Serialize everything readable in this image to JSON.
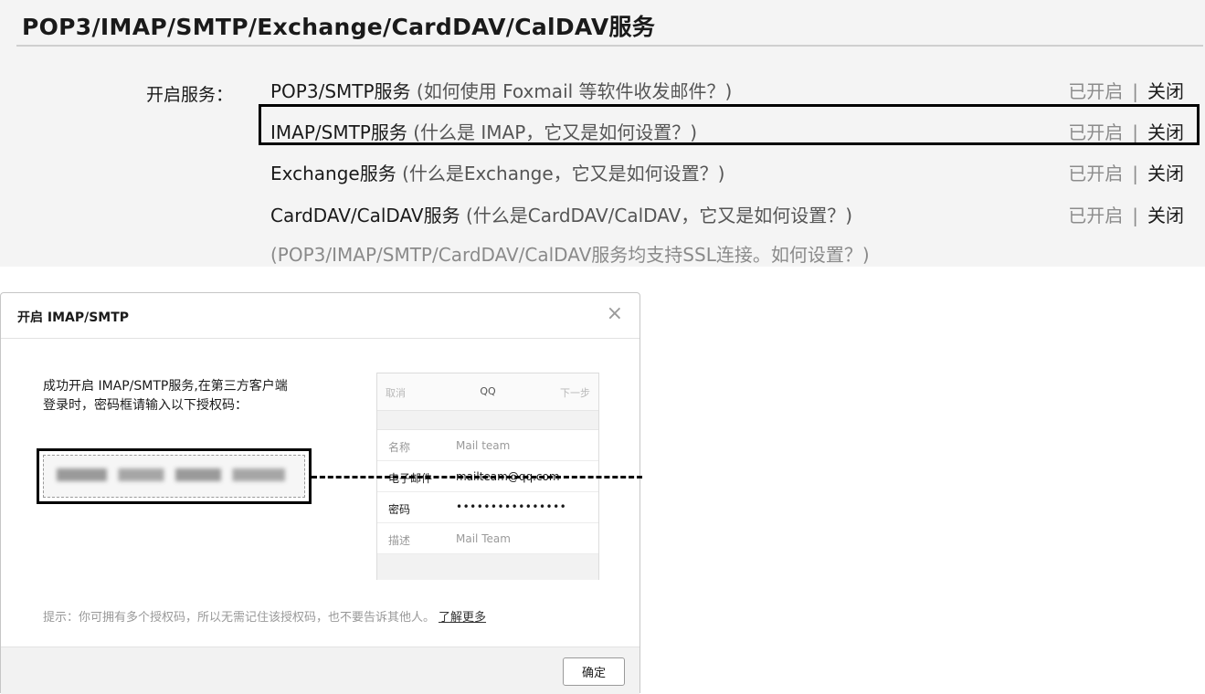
{
  "settings": {
    "title": "POP3/IMAP/SMTP/Exchange/CardDAV/CalDAV服务",
    "open_label": "开启服务：",
    "services": [
      {
        "name": "POP3/SMTP服务",
        "help": "(如何使用 Foxmail 等软件收发邮件？)",
        "status_on": "已开启",
        "separator": "|",
        "status_off": "关闭"
      },
      {
        "name": "IMAP/SMTP服务",
        "help": "(什么是 IMAP，它又是如何设置？)",
        "status_on": "已开启",
        "separator": "|",
        "status_off": "关闭"
      },
      {
        "name": "Exchange服务",
        "help": "(什么是Exchange，它又是如何设置？)",
        "status_on": "已开启",
        "separator": "|",
        "status_off": "关闭"
      },
      {
        "name": "CardDAV/CalDAV服务",
        "help": "(什么是CardDAV/CalDAV，它又是如何设置？)",
        "status_on": "已开启",
        "separator": "|",
        "status_off": "关闭"
      }
    ],
    "ssl_note": "(POP3/IMAP/SMTP/CardDAV/CalDAV服务均支持SSL连接。如何设置？)"
  },
  "dialog": {
    "title": "开启 IMAP/SMTP",
    "close_glyph": "×",
    "success_line1": "成功开启 IMAP/SMTP服务,在第三方客户端",
    "success_line2": "登录时，密码框请输入以下授权码：",
    "phone": {
      "cancel": "取消",
      "title": "QQ",
      "next": "下一步",
      "rows": [
        {
          "key": "名称",
          "value": "Mail team"
        },
        {
          "key": "电子邮件",
          "value": "mailteam@qq.com"
        },
        {
          "key": "密码",
          "value": "••••••••••••••••"
        },
        {
          "key": "描述",
          "value": "Mail Team"
        }
      ]
    },
    "hint": "提示：你可拥有多个授权码，所以无需记住该授权码，也不要告诉其他人。",
    "learn_more": "了解更多",
    "confirm": "确定"
  },
  "colors": {
    "panel_bg": "#f4f4f4",
    "muted_text": "#8c8c8c",
    "highlight_border": "#000000"
  }
}
